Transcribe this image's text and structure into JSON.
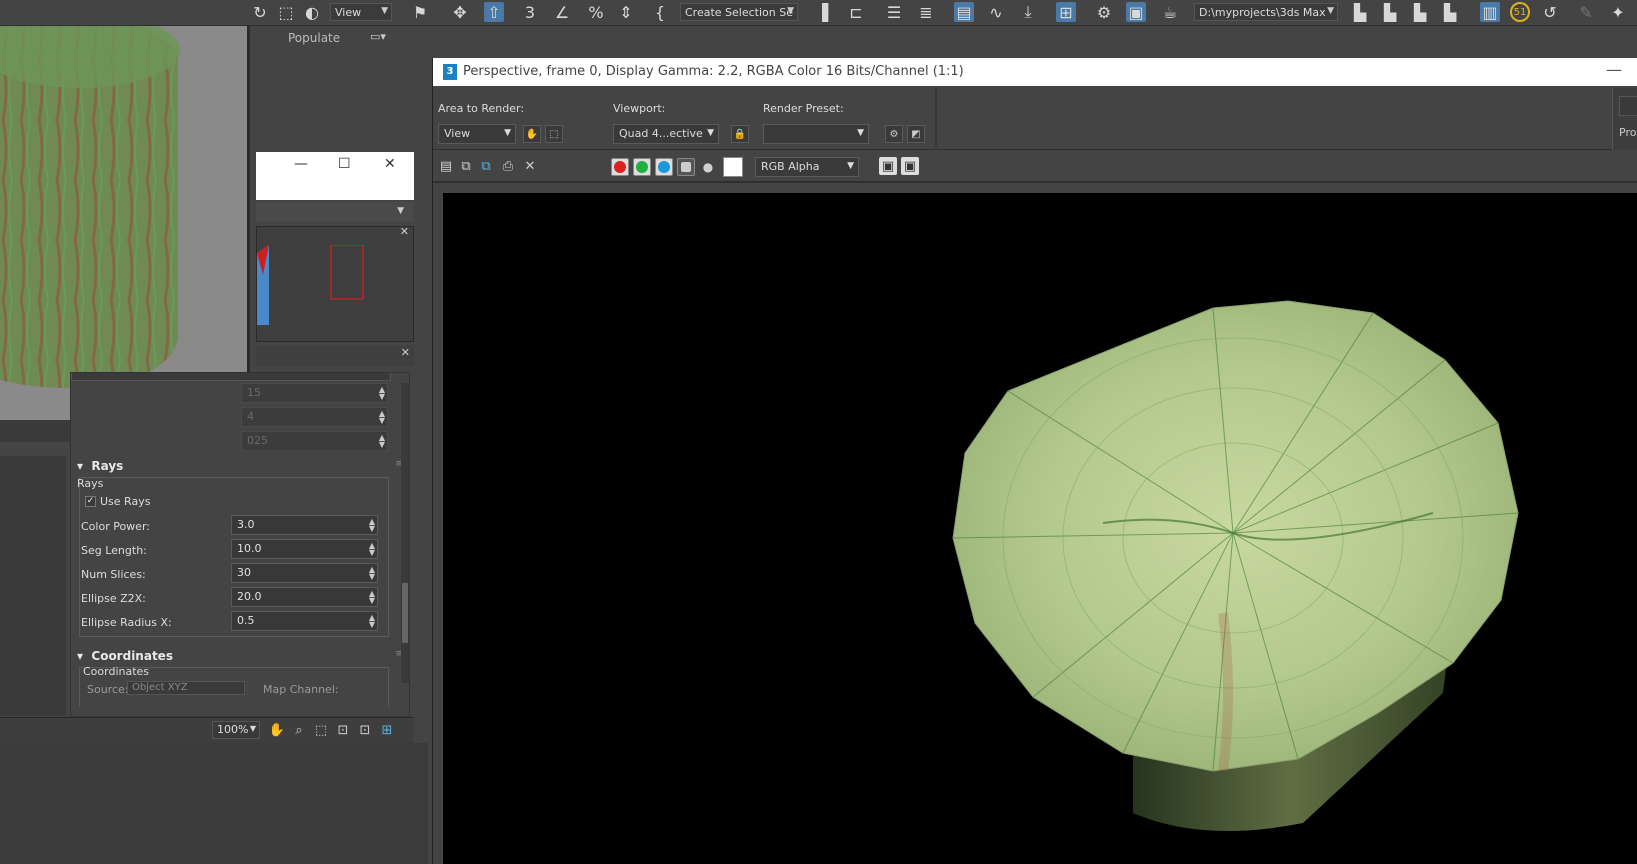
{
  "main_toolbar": {
    "view_dropdown": "View",
    "selection_set": "Create Selection Se",
    "project_path": "D:\\myprojects\\3ds Max",
    "badge_number": "51"
  },
  "ribbon": {
    "populate_tab": "Populate"
  },
  "material_editor": {
    "rays_header": "Rays",
    "rays_group": "Rays",
    "use_rays_label": "Use Rays",
    "use_rays_checked": true,
    "params": [
      {
        "label": "Color Power:",
        "value": "3.0"
      },
      {
        "label": "Seg Length:",
        "value": "10.0"
      },
      {
        "label": "Num Slices:",
        "value": "30"
      },
      {
        "label": "Ellipse Z2X:",
        "value": "20.0"
      },
      {
        "label": "Ellipse Radius X:",
        "value": "0.5"
      }
    ],
    "dim_values": [
      "15",
      "4",
      "025"
    ],
    "coordinates_header": "Coordinates",
    "coordinates_group": "Coordinates",
    "source_label": "Source:",
    "source_value": "Object XYZ",
    "map_channel_label": "Map Channel:",
    "zoom_level": "100%"
  },
  "render_window": {
    "title": "Perspective, frame 0, Display Gamma: 2.2, RGBA Color 16 Bits/Channel (1:1)",
    "app_icon": "3",
    "area_to_render_label": "Area to Render:",
    "area_to_render_value": "View",
    "viewport_label": "Viewport:",
    "viewport_value": "Quad 4...ective",
    "render_preset_label": "Render Preset:",
    "render_preset_value": "",
    "production_button": "Pro",
    "channel_display": "RGB Alpha",
    "channel_colors": {
      "red": "#e02020",
      "green": "#20b040",
      "blue": "#1a9ad8"
    }
  }
}
